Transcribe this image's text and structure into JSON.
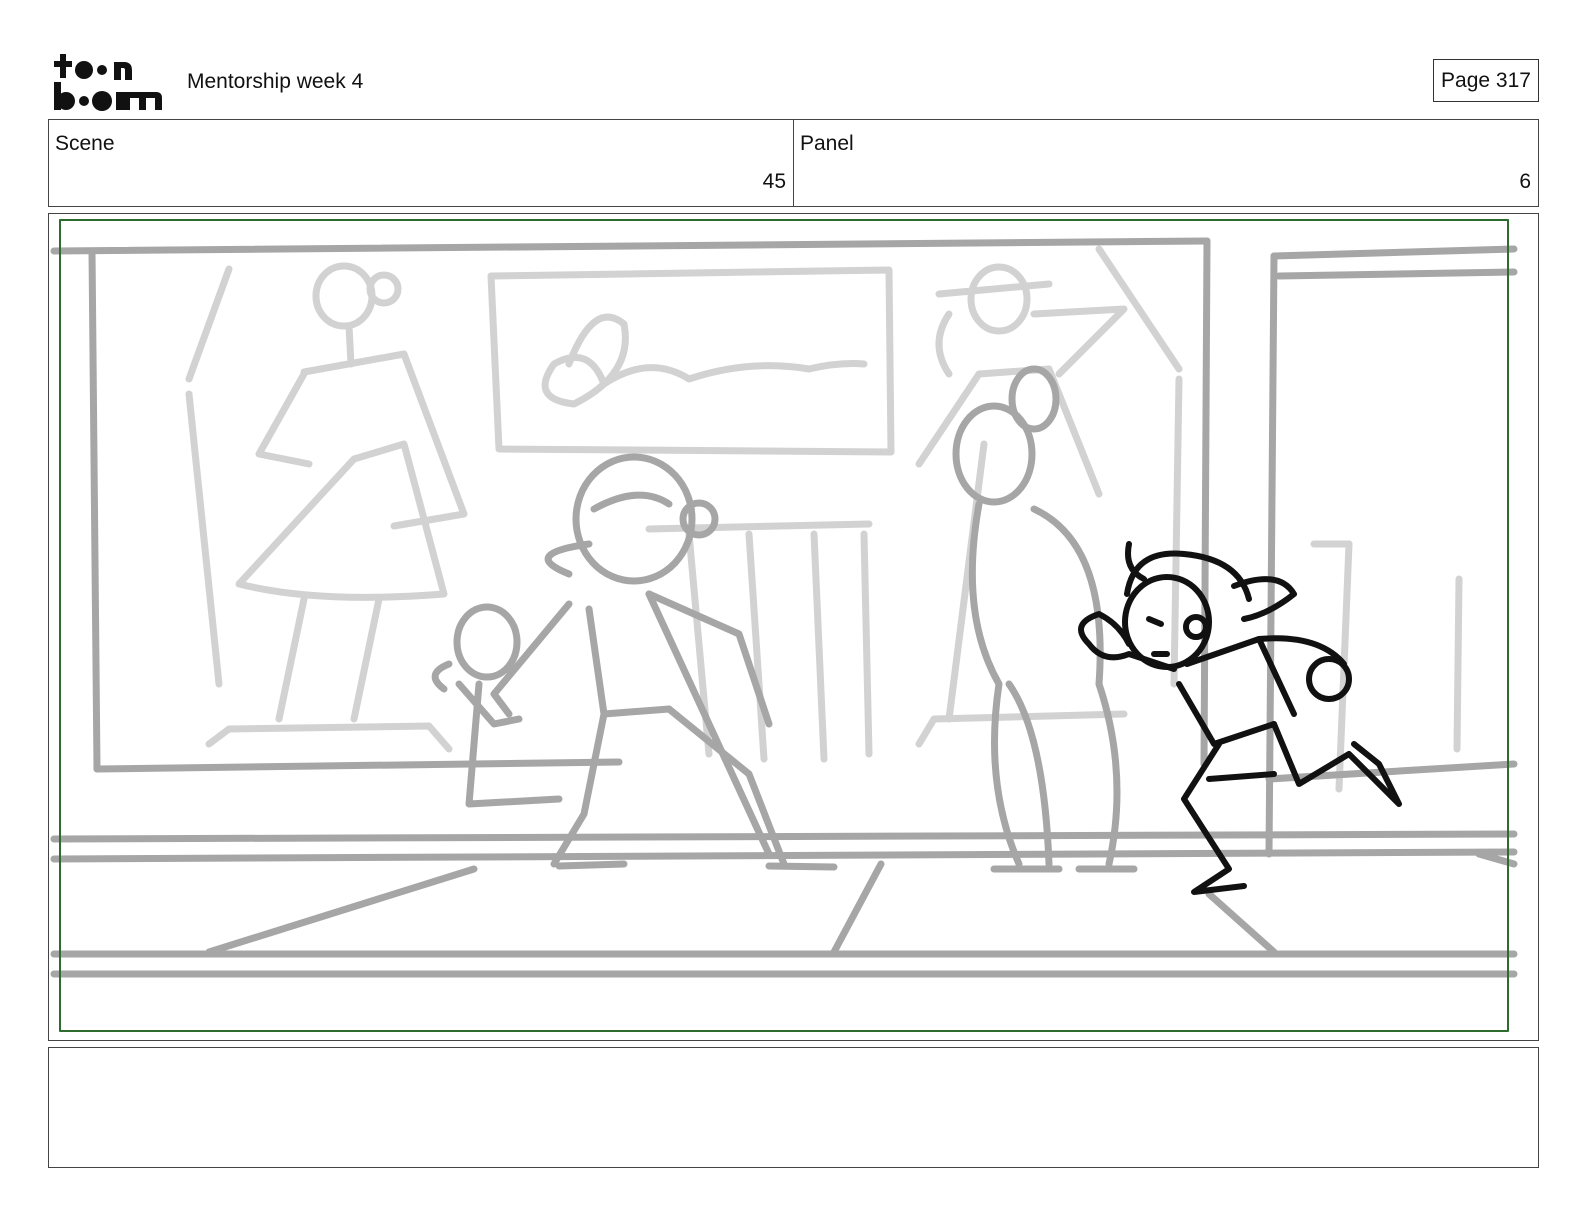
{
  "header": {
    "logo_alt": "toon boom",
    "project_title": "Mentorship week 4",
    "page_label": "Page 317"
  },
  "info": {
    "scene_label": "Scene",
    "scene_value": "45",
    "panel_label": "Panel",
    "panel_value": "6"
  },
  "colors": {
    "safe_frame": "#2e6b2e",
    "sketch_light": "#d2d2d2",
    "sketch_mid": "#a6a6a6",
    "sketch_dark": "#111111"
  },
  "notes": {
    "text": ""
  }
}
